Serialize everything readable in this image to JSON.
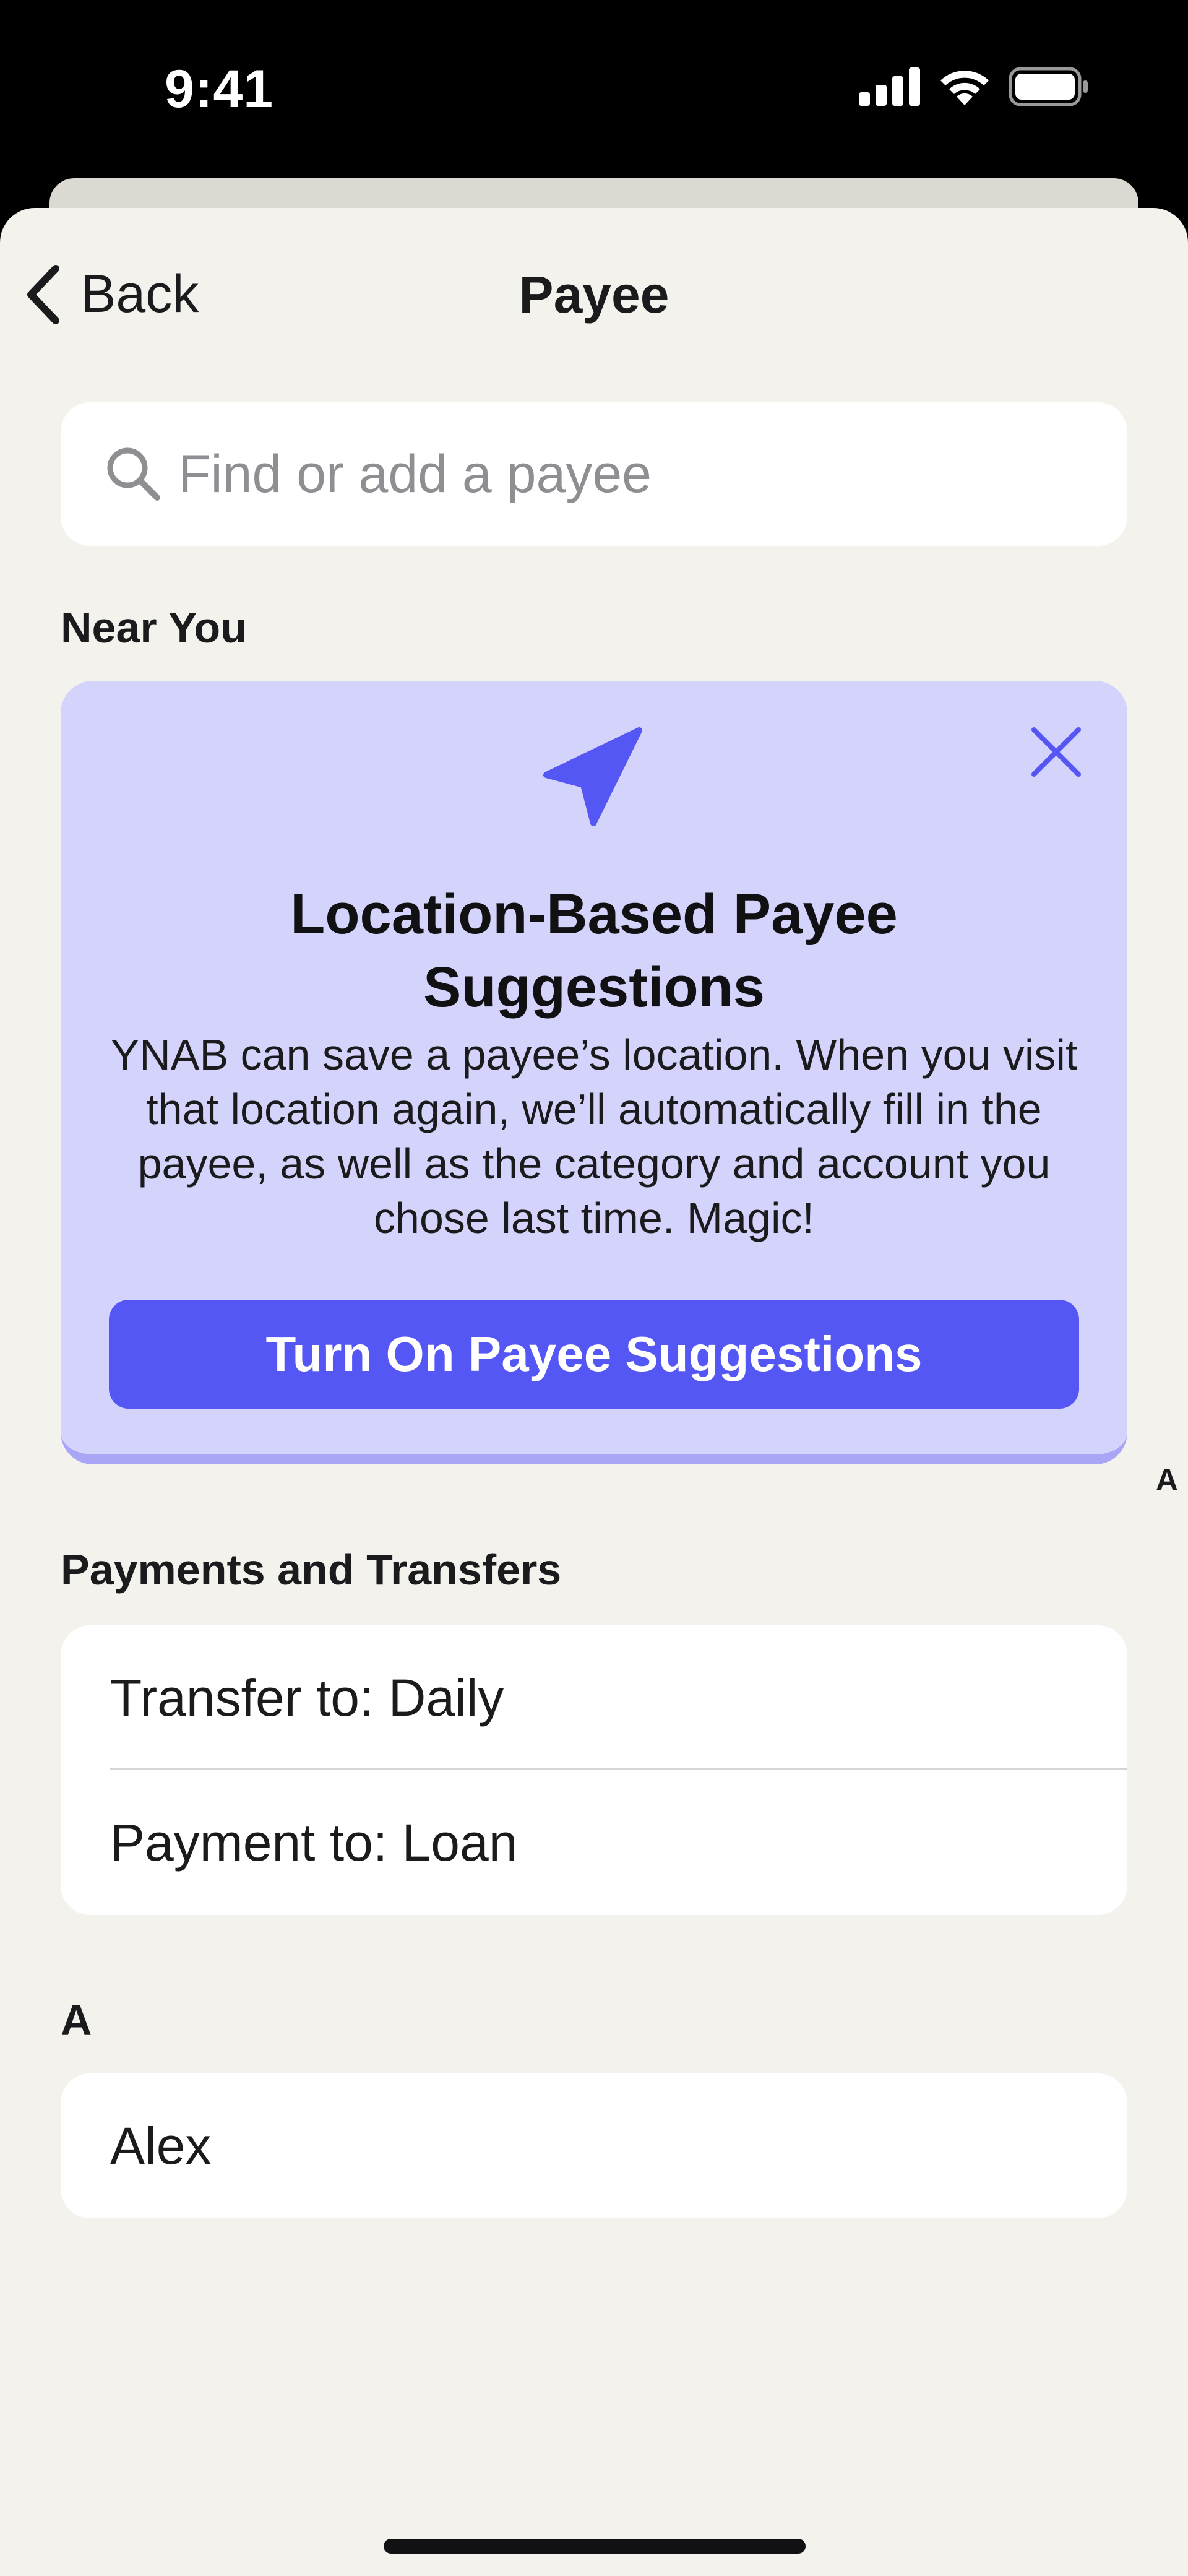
{
  "status_bar": {
    "time": "9:41"
  },
  "nav": {
    "back_label": "Back",
    "title": "Payee"
  },
  "search": {
    "value": "",
    "placeholder": "Find or add a payee"
  },
  "near_you": {
    "header": "Near You",
    "promo": {
      "title": "Location-Based Payee Suggestions",
      "body": "YNAB can save a payee’s location. When you visit that location again, we’ll automatically fill in the payee, as well as the category and account you chose last time. Magic!",
      "button_label": "Turn On Payee Suggestions",
      "icon": "location-arrow-icon",
      "accent_color": "#5557f5",
      "background_color": "#d4d3fb"
    }
  },
  "index": {
    "letters": [
      "A"
    ]
  },
  "payments_transfers": {
    "header": "Payments and Transfers",
    "items": [
      {
        "label": "Transfer to: Daily"
      },
      {
        "label": "Payment to: Loan"
      }
    ]
  },
  "payees_a": {
    "header": "A",
    "items": [
      {
        "label": "Alex"
      }
    ]
  }
}
